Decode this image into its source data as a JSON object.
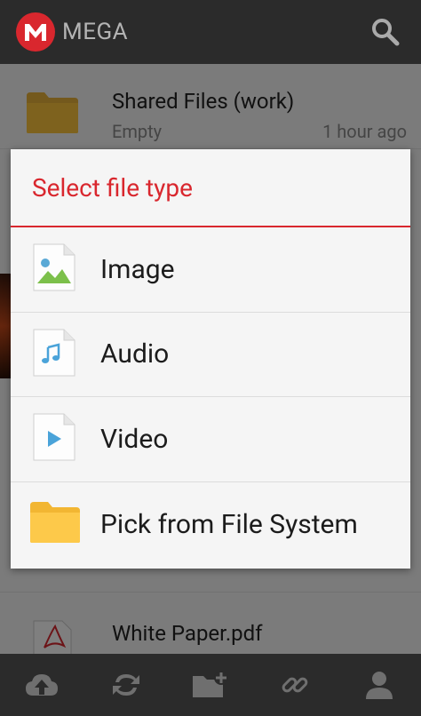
{
  "app": {
    "title": "MEGA",
    "accent_color": "#d9272e"
  },
  "list": {
    "items": [
      {
        "name": "Shared Files (work)",
        "meta": "Empty",
        "time": "1 hour ago",
        "icon": "folder-icon"
      },
      {
        "name": "White Paper.pdf",
        "icon": "pdf-file-icon"
      }
    ]
  },
  "dialog": {
    "title": "Select file type",
    "options": [
      {
        "label": "Image",
        "icon": "image-file-icon"
      },
      {
        "label": "Audio",
        "icon": "audio-file-icon"
      },
      {
        "label": "Video",
        "icon": "video-file-icon"
      },
      {
        "label": "Pick from File System",
        "icon": "folder-icon"
      }
    ]
  },
  "toolbar": {
    "buttons": [
      "upload-icon",
      "sync-icon",
      "new-folder-icon",
      "link-icon",
      "account-icon"
    ]
  }
}
